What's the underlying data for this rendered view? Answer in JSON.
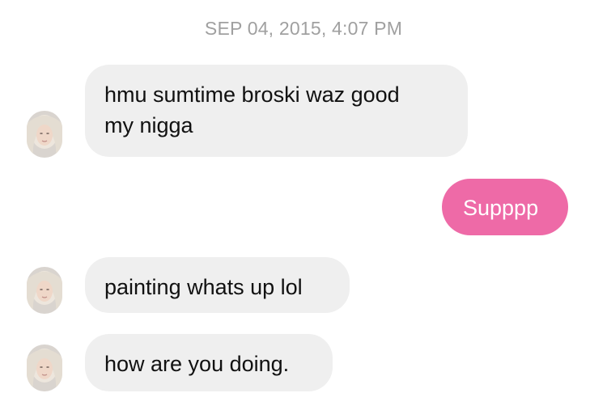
{
  "timestamp": "SEP 04, 2015, 4:07 PM",
  "messages": [
    {
      "from": "them",
      "line1": "hmu sumtime broski waz good",
      "line2": "my nigga"
    },
    {
      "from": "me",
      "text": "Supppp"
    },
    {
      "from": "them",
      "text": "painting whats up lol"
    },
    {
      "from": "them",
      "text": "how are you doing."
    }
  ],
  "colors": {
    "incoming_bubble": "#efefef",
    "outgoing_bubble": "#ee6aa7",
    "timestamp_text": "#a0a0a0"
  },
  "icons": {
    "avatar": "contact-avatar"
  }
}
